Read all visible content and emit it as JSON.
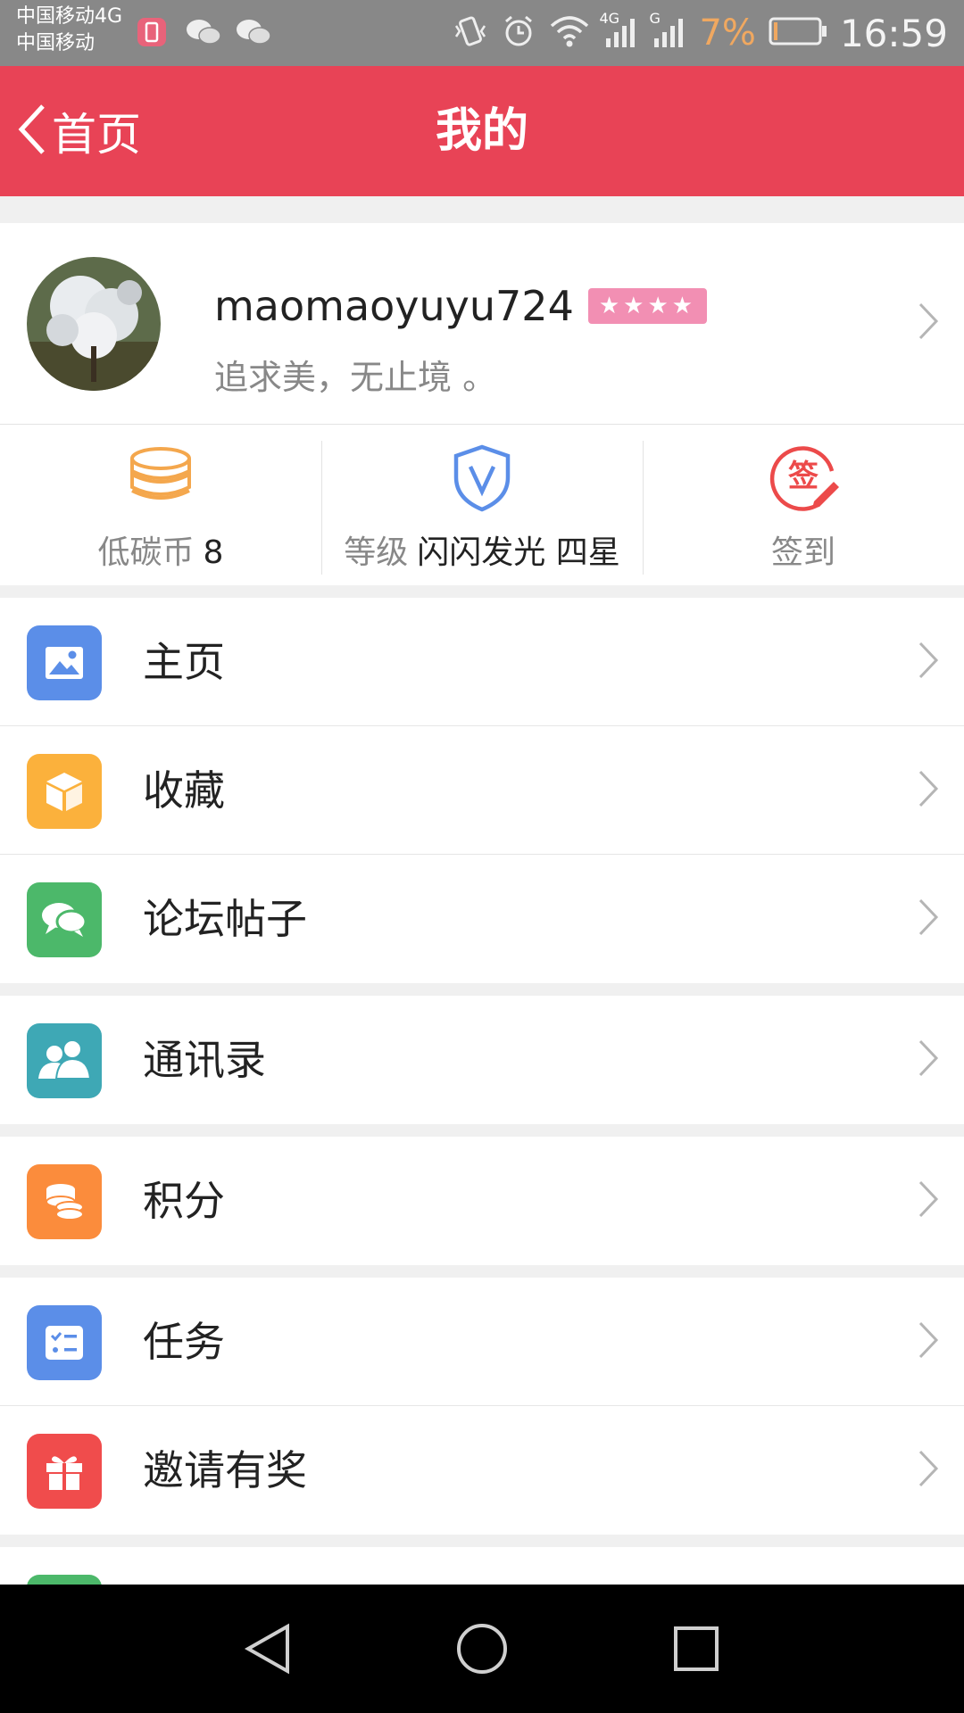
{
  "status_bar": {
    "carrier_1": "中国移动4G",
    "carrier_2": "中国移动",
    "network_1": "4G",
    "network_2": "G",
    "battery": "7%",
    "time": "16:59"
  },
  "app_bar": {
    "back_label": "首页",
    "title": "我的",
    "background": "#e84356"
  },
  "profile": {
    "username": "maomaoyuyu724",
    "stars": "★★★★",
    "star_count": 4,
    "signature": "追求美，无止境 。"
  },
  "stats": {
    "coins_label": "低碳币",
    "coins_value": "8",
    "level_label": "等级",
    "level_value": "闪闪发光 四星",
    "checkin_label": "签到",
    "checkin_badge": "签"
  },
  "menu": {
    "items": [
      {
        "label": "主页",
        "icon": "image-icon",
        "color": "#5b8ee8"
      },
      {
        "label": "收藏",
        "icon": "box-icon",
        "color": "#fbb13c"
      },
      {
        "label": "论坛帖子",
        "icon": "chat-bubbles-icon",
        "color": "#4cb86a"
      },
      {
        "label": "通讯录",
        "icon": "contacts-icon",
        "color": "#3ea8b5"
      },
      {
        "label": "积分",
        "icon": "coins-icon",
        "color": "#fb8c3c"
      },
      {
        "label": "任务",
        "icon": "task-list-icon",
        "color": "#5b8ee8"
      },
      {
        "label": "邀请有奖",
        "icon": "gift-icon",
        "color": "#f04c4c"
      }
    ]
  }
}
